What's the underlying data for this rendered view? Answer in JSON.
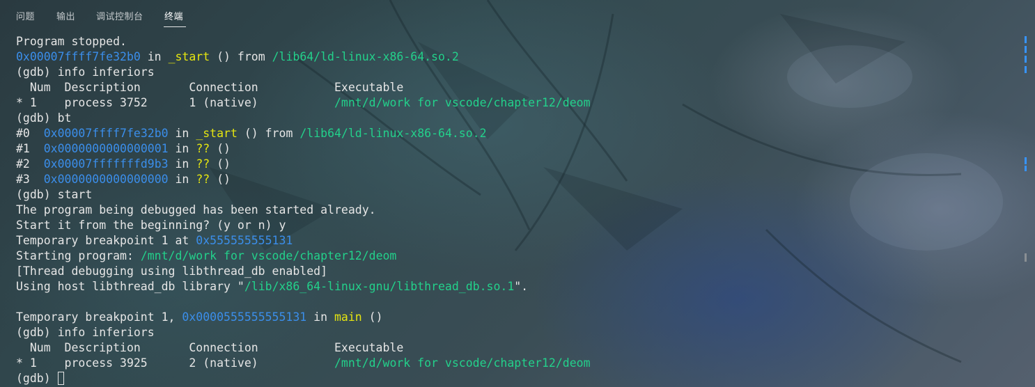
{
  "tabs": [
    {
      "label": "问题"
    },
    {
      "label": "输出"
    },
    {
      "label": "调试控制台"
    },
    {
      "label": "终端",
      "active": true
    }
  ],
  "terminal": {
    "lines": [
      [
        {
          "t": "Program stopped."
        }
      ],
      [
        {
          "t": "0x00007ffff7fe32b0",
          "c": "addr"
        },
        {
          "t": " in "
        },
        {
          "t": "_start",
          "c": "fn"
        },
        {
          "t": " () from "
        },
        {
          "t": "/lib64/ld-linux-x86-64.so.2",
          "c": "path"
        }
      ],
      [
        {
          "t": "(gdb) info inferiors"
        }
      ],
      [
        {
          "t": "  Num  Description       Connection           Executable"
        }
      ],
      [
        {
          "t": "* 1    process 3752      1 (native)           "
        },
        {
          "t": "/mnt/d/work for vscode/chapter12/deom",
          "c": "path"
        }
      ],
      [
        {
          "t": "(gdb) bt"
        }
      ],
      [
        {
          "t": "#0  "
        },
        {
          "t": "0x00007ffff7fe32b0",
          "c": "addr"
        },
        {
          "t": " in "
        },
        {
          "t": "_start",
          "c": "fn"
        },
        {
          "t": " () from "
        },
        {
          "t": "/lib64/ld-linux-x86-64.so.2",
          "c": "path"
        }
      ],
      [
        {
          "t": "#1  "
        },
        {
          "t": "0x0000000000000001",
          "c": "addr"
        },
        {
          "t": " in "
        },
        {
          "t": "??",
          "c": "fn"
        },
        {
          "t": " ()"
        }
      ],
      [
        {
          "t": "#2  "
        },
        {
          "t": "0x00007fffffffd9b3",
          "c": "addr"
        },
        {
          "t": " in "
        },
        {
          "t": "??",
          "c": "fn"
        },
        {
          "t": " ()"
        }
      ],
      [
        {
          "t": "#3  "
        },
        {
          "t": "0x0000000000000000",
          "c": "addr"
        },
        {
          "t": " in "
        },
        {
          "t": "??",
          "c": "fn"
        },
        {
          "t": " ()"
        }
      ],
      [
        {
          "t": "(gdb) start"
        }
      ],
      [
        {
          "t": "The program being debugged has been started already."
        }
      ],
      [
        {
          "t": "Start it from the beginning? (y or n) y"
        }
      ],
      [
        {
          "t": "Temporary breakpoint 1 at "
        },
        {
          "t": "0x555555555131",
          "c": "addr"
        }
      ],
      [
        {
          "t": "Starting program: "
        },
        {
          "t": "/mnt/d/work for vscode/chapter12/deom",
          "c": "path"
        }
      ],
      [
        {
          "t": "[Thread debugging using libthread_db enabled]"
        }
      ],
      [
        {
          "t": "Using host libthread_db library \""
        },
        {
          "t": "/lib/x86_64-linux-gnu/libthread_db.so.1",
          "c": "path"
        },
        {
          "t": "\"."
        }
      ],
      [
        {
          "t": ""
        }
      ],
      [
        {
          "t": "Temporary breakpoint 1, "
        },
        {
          "t": "0x0000555555555131",
          "c": "addr"
        },
        {
          "t": " in "
        },
        {
          "t": "main",
          "c": "fn"
        },
        {
          "t": " ()"
        }
      ],
      [
        {
          "t": "(gdb) info inferiors"
        }
      ],
      [
        {
          "t": "  Num  Description       Connection           Executable"
        }
      ],
      [
        {
          "t": "* 1    process 3925      2 (native)           "
        },
        {
          "t": "/mnt/d/work for vscode/chapter12/deom",
          "c": "path"
        }
      ],
      [
        {
          "t": "(gdb) "
        },
        {
          "t": "",
          "c": "cursor"
        }
      ]
    ]
  },
  "colors": {
    "address": "#3b8eea",
    "function": "#e5e510",
    "path": "#23d18b",
    "text": "#e6e6e6",
    "scroll_marker": "#3794ff"
  }
}
